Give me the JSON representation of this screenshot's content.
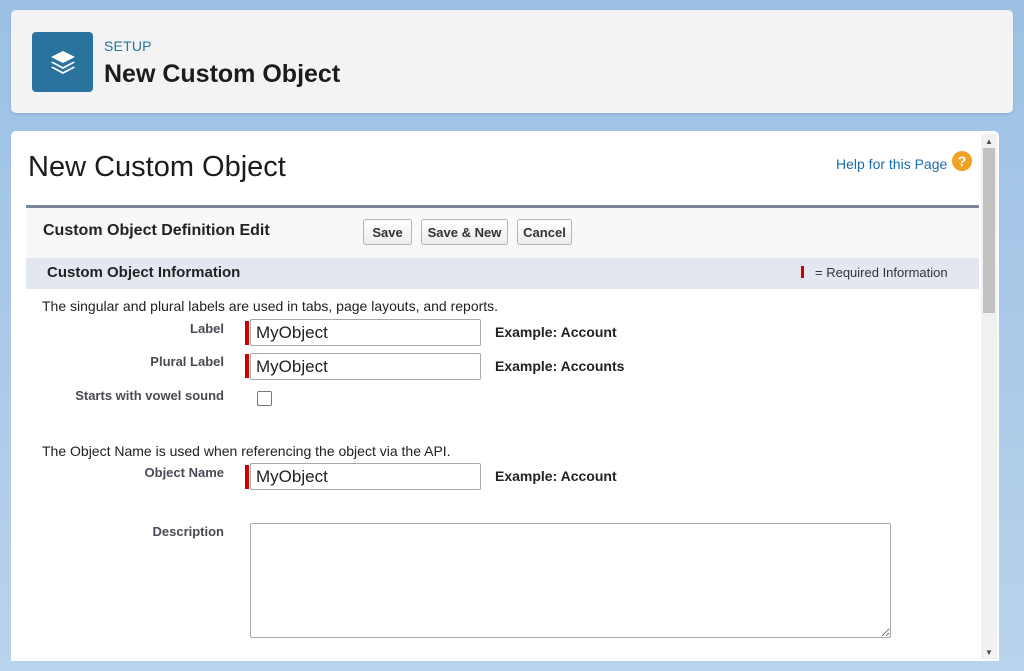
{
  "header": {
    "icon": "layers-icon",
    "setup_label": "SETUP",
    "title": "New Custom Object"
  },
  "page": {
    "title": "New Custom Object",
    "help_link": "Help for this Page",
    "help_icon": "help-icon"
  },
  "form": {
    "title": "Custom Object Definition Edit",
    "buttons": {
      "save": "Save",
      "save_new": "Save & New",
      "cancel": "Cancel"
    },
    "section": {
      "title": "Custom Object Information",
      "required_legend": "= Required Information"
    },
    "labels_info": "The singular and plural labels are used in tabs, page layouts, and reports.",
    "label_field": {
      "label": "Label",
      "value": "MyObject",
      "example": "Example:  Account"
    },
    "plural_field": {
      "label": "Plural Label",
      "value": "MyObject",
      "example": "Example:  Accounts"
    },
    "vowel_field": {
      "label": "Starts with vowel sound",
      "checked": false
    },
    "api_info": "The Object Name is used when referencing the object via the API.",
    "object_name_field": {
      "label": "Object Name",
      "value": "MyObject",
      "example": "Example:  Account"
    },
    "description_field": {
      "label": "Description",
      "value": ""
    }
  },
  "colors": {
    "accent": "#2a739e",
    "link": "#1b6cad",
    "required": "#cc0000",
    "help_icon": "#f0a225"
  }
}
